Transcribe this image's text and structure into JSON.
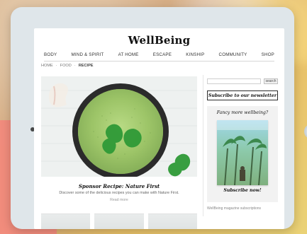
{
  "site": {
    "logo": "WellBeing",
    "nav_items": [
      "BODY",
      "MIND & SPIRIT",
      "AT HOME",
      "ESCAPE",
      "KINSHIP",
      "COMMUNITY",
      "SHOP"
    ],
    "breadcrumb": [
      "HOME",
      "FOOD",
      "RECIPE"
    ]
  },
  "main": {
    "hero_title": "Sponsor Recipe: Nature First",
    "hero_subtitle": "Discover some of the delicious recipes you can make with Nature First.",
    "hero_link": "Read more"
  },
  "sidebar": {
    "search_placeholder": "",
    "search_button": "search",
    "newsletter_label": "Subscribe to our newsletter",
    "promo_title": "Fancy more wellbeing?",
    "promo_cta": "Subscribe now!",
    "footer_text": "WellBeing magazine subscriptions"
  },
  "colors": {
    "tablet_bezel": "#dfe6ea",
    "site_bg": "#ffffff",
    "accent_text": "#111111"
  }
}
